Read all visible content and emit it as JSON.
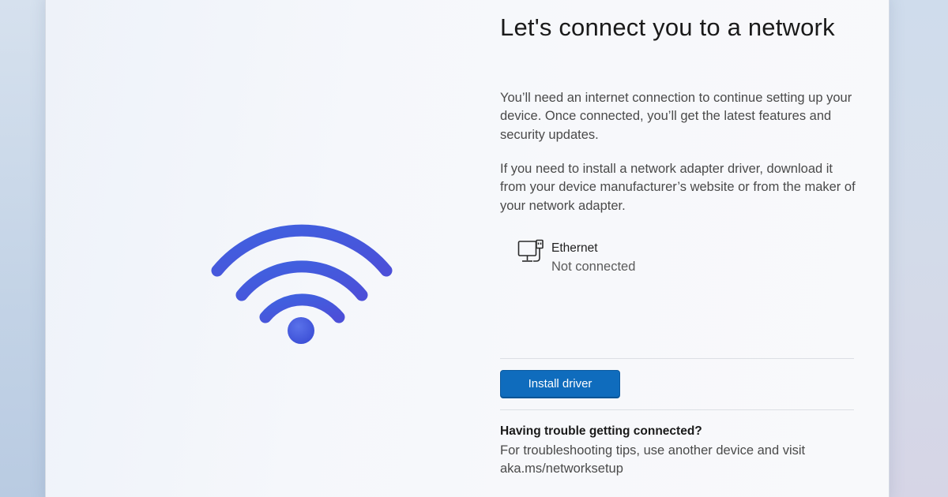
{
  "page": {
    "title": "Let's connect you to a network",
    "description_1": "You’ll need an internet connection to continue setting up your device. Once connected, you’ll get the latest features and security updates.",
    "description_2": "If you need to install a network adapter driver, download it from your device manufacturer’s website or from the maker of your network adapter."
  },
  "network": {
    "icon": "ethernet-icon",
    "name": "Ethernet",
    "status": "Not connected"
  },
  "actions": {
    "install_driver_label": "Install driver"
  },
  "help": {
    "title": "Having trouble getting connected?",
    "text": "For troubleshooting tips, use another device and visit",
    "link": "aka.ms/networksetup"
  },
  "illustration": {
    "icon": "wifi-icon"
  },
  "colors": {
    "accent": "#0f6cbd",
    "wifi_blue": "#3d5bd9",
    "wifi_violet": "#5a4be0"
  }
}
